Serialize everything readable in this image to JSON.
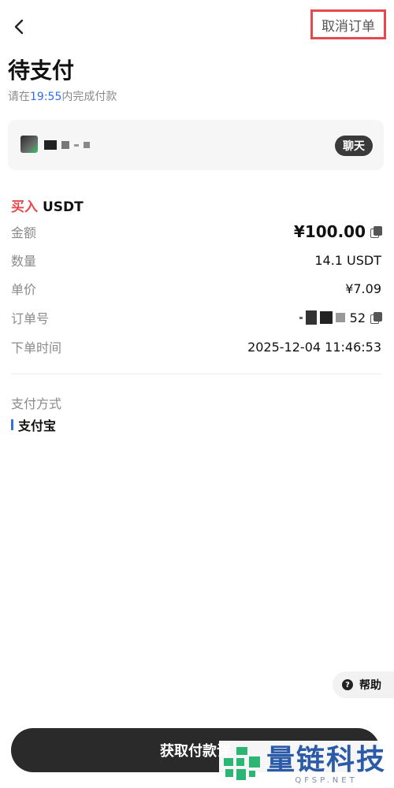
{
  "header": {
    "back_icon": "chevron-left-icon",
    "cancel_label": "取消订单"
  },
  "page": {
    "title": "待支付",
    "subtitle_prefix": "请在",
    "countdown": "19:55",
    "subtitle_suffix": "内完成付款"
  },
  "merchant": {
    "name": "",
    "chat_label": "聊天"
  },
  "trade": {
    "side": "买入",
    "asset": "USDT"
  },
  "details": {
    "amount_label": "金额",
    "amount_value": "¥100.00",
    "quantity_label": "数量",
    "quantity_value": "14.1 USDT",
    "price_label": "单价",
    "price_value": "¥7.09",
    "order_no_label": "订单号",
    "order_no_suffix": "52",
    "time_label": "下单时间",
    "time_value": "2025-12-04 11:46:53"
  },
  "payment": {
    "label": "支付方式",
    "method": "支付宝"
  },
  "help": {
    "label": "帮助",
    "icon_glyph": "?"
  },
  "cta": {
    "label": "获取付款详"
  },
  "watermark": {
    "cn": "量链科技",
    "en": "QFSP.NET"
  },
  "colors": {
    "accent_red": "#e5484d",
    "accent_blue": "#2f6fe8",
    "cta_bg": "#2a2a2a",
    "watermark_blue": "#2a5aa8",
    "watermark_green": "#2bb673"
  }
}
